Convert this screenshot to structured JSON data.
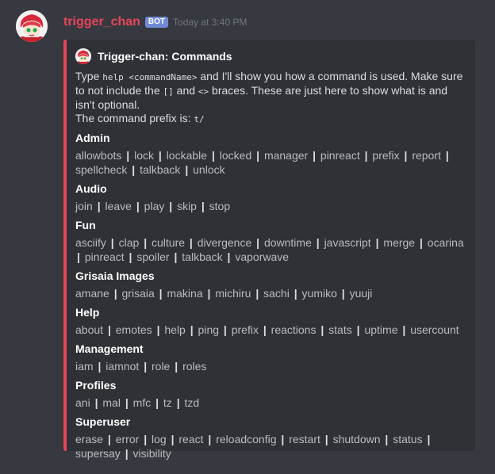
{
  "message": {
    "username": "trigger_chan",
    "badge": "BOT",
    "timestamp": "Today at 3:40 PM"
  },
  "embed": {
    "accent_color": "#e9445a",
    "author": "Trigger-chan: Commands",
    "desc_type": "Type ",
    "desc_code1": "help <commandName>",
    "desc_mid": " and I'll show you how a command is used. Make sure to not include the ",
    "desc_code2": "[]",
    "desc_and": " and ",
    "desc_code3": "<>",
    "desc_end": " braces. These are just here to show what is and isn't optional.",
    "prefix_text": "The command prefix is: ",
    "prefix_code": "t/",
    "fields": [
      {
        "name": "Admin",
        "commands": [
          "allowbots",
          "lock",
          "lockable",
          "locked",
          "manager",
          "pinreact",
          "prefix",
          "report",
          "spellcheck",
          "talkback",
          "unlock"
        ]
      },
      {
        "name": "Audio",
        "commands": [
          "join",
          "leave",
          "play",
          "skip",
          "stop"
        ]
      },
      {
        "name": "Fun",
        "commands": [
          "asciify",
          "clap",
          "culture",
          "divergence",
          "downtime",
          "javascript",
          "merge",
          "ocarina",
          "pinreact",
          "spoiler",
          "talkback",
          "vaporwave"
        ]
      },
      {
        "name": "Grisaia Images",
        "commands": [
          "amane",
          "grisaia",
          "makina",
          "michiru",
          "sachi",
          "yumiko",
          "yuuji"
        ]
      },
      {
        "name": "Help",
        "commands": [
          "about",
          "emotes",
          "help",
          "ping",
          "prefix",
          "reactions",
          "stats",
          "uptime",
          "usercount"
        ]
      },
      {
        "name": "Management",
        "commands": [
          "iam",
          "iamnot",
          "role",
          "roles"
        ]
      },
      {
        "name": "Profiles",
        "commands": [
          "ani",
          "mal",
          "mfc",
          "tz",
          "tzd"
        ]
      },
      {
        "name": "Superuser",
        "commands": [
          "erase",
          "error",
          "log",
          "react",
          "reloadconfig",
          "restart",
          "shutdown",
          "status",
          "supersay",
          "visibility"
        ]
      }
    ]
  }
}
